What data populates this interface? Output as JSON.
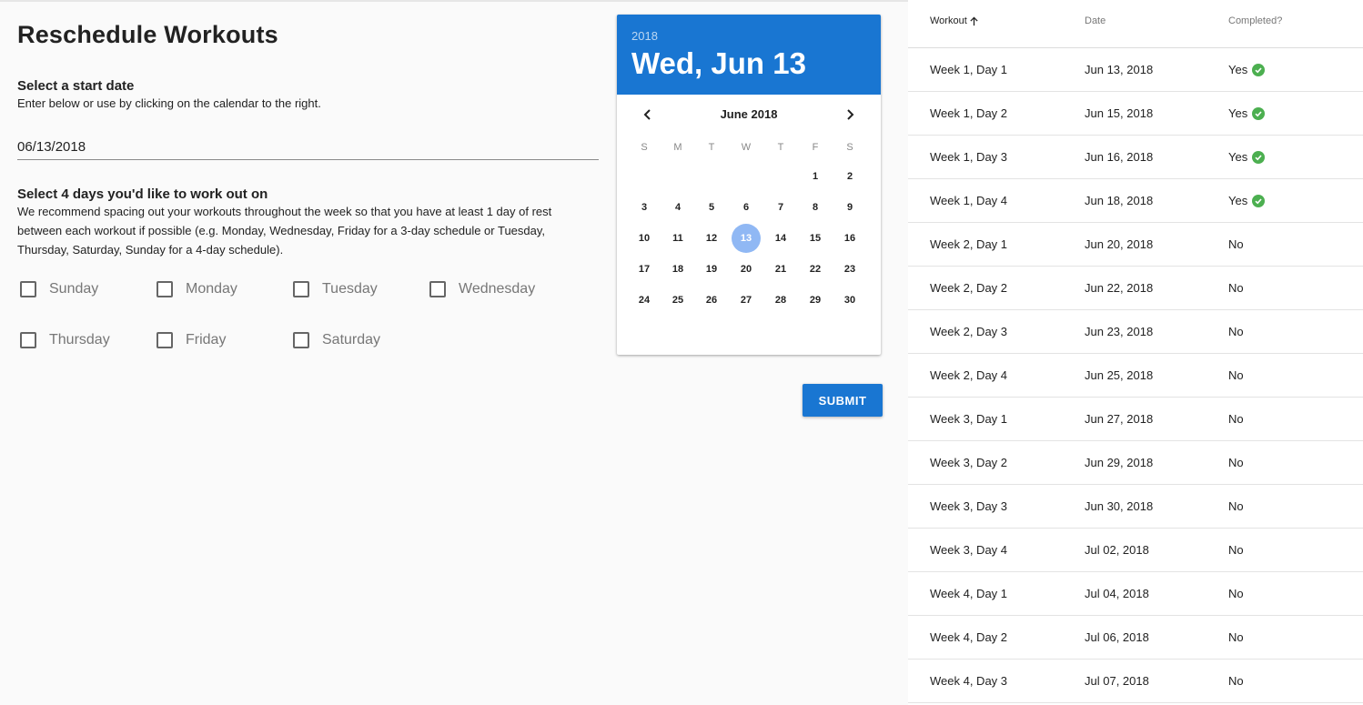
{
  "page": {
    "title": "Reschedule Workouts",
    "start_date_heading": "Select a start date",
    "start_date_helper": "Enter below or use by clicking on the calendar to the right.",
    "start_date_value": "06/13/2018",
    "days_heading": "Select 4 days you'd like to work out on",
    "days_helper_line1": "We recommend spacing out your workouts throughout the week so that you have at least 1 day of rest",
    "days_helper_line2": "between each workout if possible (e.g. Monday, Wednesday, Friday for a 3-day schedule or Tuesday,",
    "days_helper_line3": "Thursday, Saturday, Sunday for a 4-day schedule).",
    "day_options": [
      {
        "label": "Sunday",
        "checked": false
      },
      {
        "label": "Monday",
        "checked": false
      },
      {
        "label": "Tuesday",
        "checked": false
      },
      {
        "label": "Wednesday",
        "checked": false
      },
      {
        "label": "Thursday",
        "checked": false
      },
      {
        "label": "Friday",
        "checked": false
      },
      {
        "label": "Saturday",
        "checked": false
      }
    ],
    "submit_label": "SUBMIT"
  },
  "calendar": {
    "year": "2018",
    "selected_date": "Wed, Jun 13",
    "month_label": "June 2018",
    "weekday_labels": [
      "S",
      "M",
      "T",
      "W",
      "T",
      "F",
      "S"
    ],
    "first_weekday_index": 5,
    "days_in_month": 30,
    "selected_day": 13,
    "accent_color": "#1976d2",
    "selected_color": "#90b8f4"
  },
  "table": {
    "headers": {
      "workout": "Workout",
      "date": "Date",
      "completed": "Completed?"
    },
    "sorted_by": "workout",
    "rows": [
      {
        "workout": "Week 1, Day 1",
        "date": "Jun 13, 2018",
        "completed": "Yes",
        "done": true
      },
      {
        "workout": "Week 1, Day 2",
        "date": "Jun 15, 2018",
        "completed": "Yes",
        "done": true
      },
      {
        "workout": "Week 1, Day 3",
        "date": "Jun 16, 2018",
        "completed": "Yes",
        "done": true
      },
      {
        "workout": "Week 1, Day 4",
        "date": "Jun 18, 2018",
        "completed": "Yes",
        "done": true
      },
      {
        "workout": "Week 2, Day 1",
        "date": "Jun 20, 2018",
        "completed": "No",
        "done": false
      },
      {
        "workout": "Week 2, Day 2",
        "date": "Jun 22, 2018",
        "completed": "No",
        "done": false
      },
      {
        "workout": "Week 2, Day 3",
        "date": "Jun 23, 2018",
        "completed": "No",
        "done": false
      },
      {
        "workout": "Week 2, Day 4",
        "date": "Jun 25, 2018",
        "completed": "No",
        "done": false
      },
      {
        "workout": "Week 3, Day 1",
        "date": "Jun 27, 2018",
        "completed": "No",
        "done": false
      },
      {
        "workout": "Week 3, Day 2",
        "date": "Jun 29, 2018",
        "completed": "No",
        "done": false
      },
      {
        "workout": "Week 3, Day 3",
        "date": "Jun 30, 2018",
        "completed": "No",
        "done": false
      },
      {
        "workout": "Week 3, Day 4",
        "date": "Jul 02, 2018",
        "completed": "No",
        "done": false
      },
      {
        "workout": "Week 4, Day 1",
        "date": "Jul 04, 2018",
        "completed": "No",
        "done": false
      },
      {
        "workout": "Week 4, Day 2",
        "date": "Jul 06, 2018",
        "completed": "No",
        "done": false
      },
      {
        "workout": "Week 4, Day 3",
        "date": "Jul 07, 2018",
        "completed": "No",
        "done": false
      }
    ],
    "check_icon": "check-circle-icon",
    "check_color": "#4caf50"
  }
}
